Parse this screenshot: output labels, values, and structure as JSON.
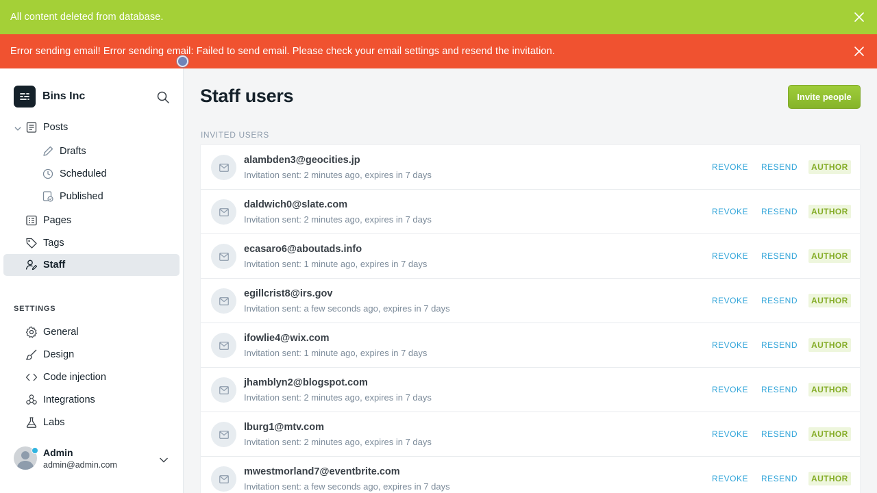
{
  "banners": {
    "success": {
      "text": "All content deleted from database.",
      "color": "#a4d037"
    },
    "error": {
      "text": "Error sending email! Error sending email: Failed to send email. Please check your email settings and resend the invitation.",
      "color": "#f05230"
    }
  },
  "sidebar": {
    "brand": "Bins Inc",
    "nav": [
      {
        "label": "Posts",
        "icon": "posts-icon"
      },
      {
        "label": "Drafts",
        "icon": "pencil-icon"
      },
      {
        "label": "Scheduled",
        "icon": "clock-icon"
      },
      {
        "label": "Published",
        "icon": "published-icon"
      },
      {
        "label": "Pages",
        "icon": "pages-icon"
      },
      {
        "label": "Tags",
        "icon": "tag-icon"
      },
      {
        "label": "Staff",
        "icon": "staff-icon",
        "active": true
      }
    ],
    "settings_label": "SETTINGS",
    "settings": [
      {
        "label": "General",
        "icon": "gear-icon"
      },
      {
        "label": "Design",
        "icon": "brush-icon"
      },
      {
        "label": "Code injection",
        "icon": "code-icon"
      },
      {
        "label": "Integrations",
        "icon": "integrations-icon"
      },
      {
        "label": "Labs",
        "icon": "flask-icon"
      }
    ],
    "account": {
      "name": "Admin",
      "email": "admin@admin.com"
    }
  },
  "main": {
    "title": "Staff users",
    "invite_button": "Invite people",
    "list_label": "INVITED USERS",
    "revoke_label": "REVOKE",
    "resend_label": "RESEND",
    "users": [
      {
        "email": "alambden3@geocities.jp",
        "meta": "Invitation sent: 2 minutes ago, expires in 7 days",
        "role": "AUTHOR"
      },
      {
        "email": "daldwich0@slate.com",
        "meta": "Invitation sent: 2 minutes ago, expires in 7 days",
        "role": "AUTHOR"
      },
      {
        "email": "ecasaro6@aboutads.info",
        "meta": "Invitation sent: 1 minute ago, expires in 7 days",
        "role": "AUTHOR"
      },
      {
        "email": "egillcrist8@irs.gov",
        "meta": "Invitation sent: a few seconds ago, expires in 7 days",
        "role": "AUTHOR"
      },
      {
        "email": "ifowlie4@wix.com",
        "meta": "Invitation sent: 1 minute ago, expires in 7 days",
        "role": "AUTHOR"
      },
      {
        "email": "jhamblyn2@blogspot.com",
        "meta": "Invitation sent: 2 minutes ago, expires in 7 days",
        "role": "AUTHOR"
      },
      {
        "email": "lburg1@mtv.com",
        "meta": "Invitation sent: 2 minutes ago, expires in 7 days",
        "role": "AUTHOR"
      },
      {
        "email": "mwestmorland7@eventbrite.com",
        "meta": "Invitation sent: a few seconds ago, expires in 7 days",
        "role": "AUTHOR"
      }
    ]
  }
}
